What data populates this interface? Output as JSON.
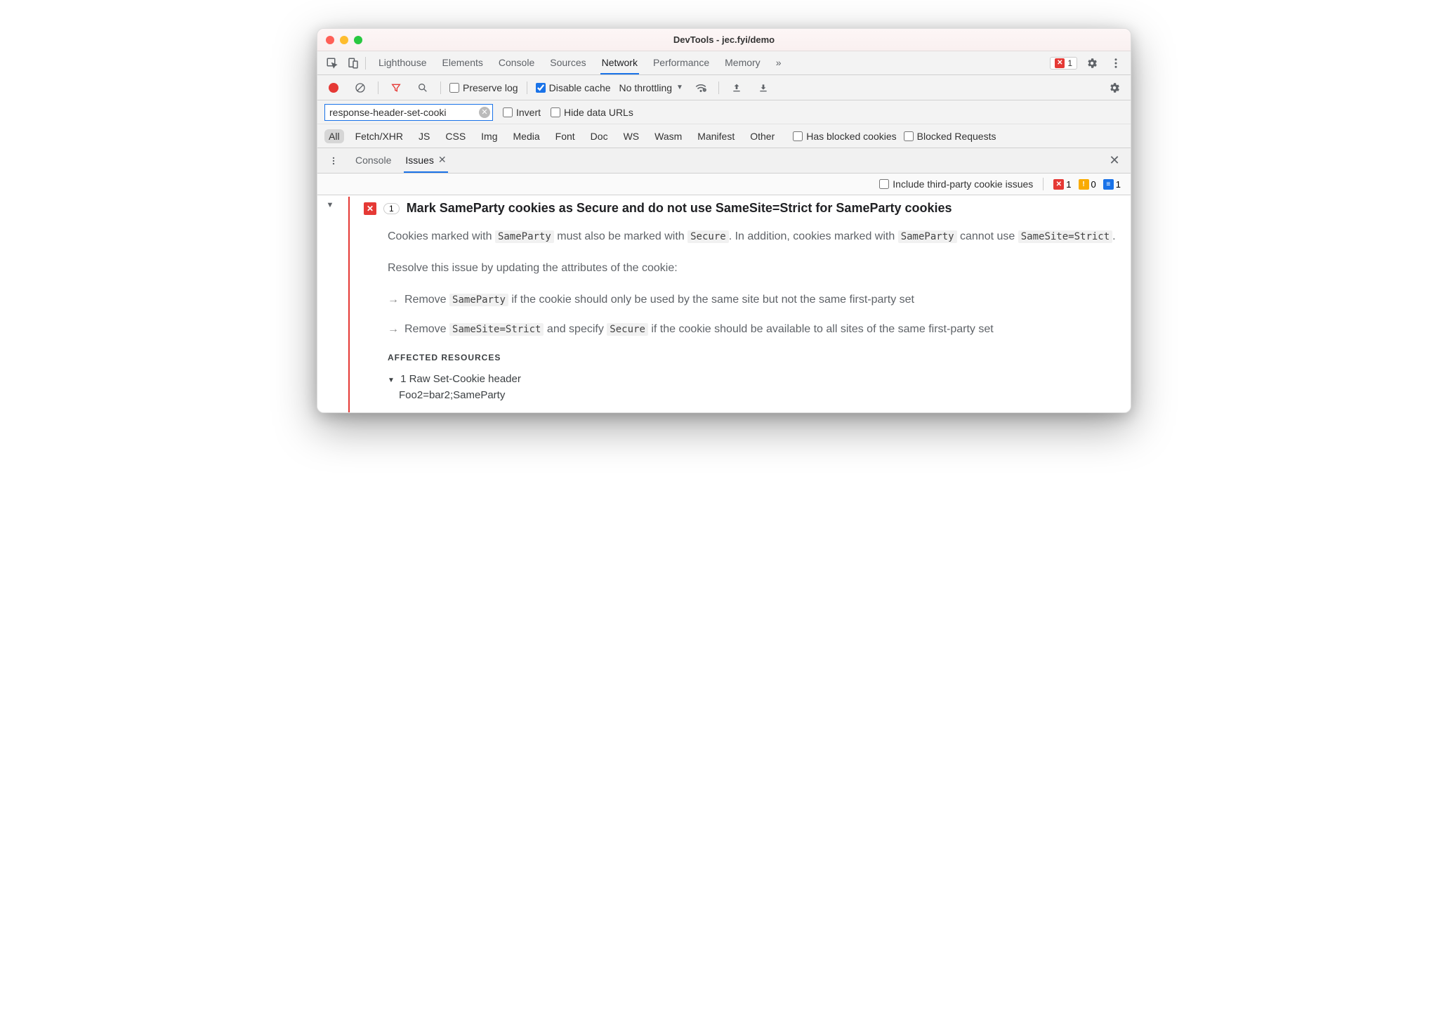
{
  "window": {
    "title": "DevTools - jec.fyi/demo"
  },
  "mainTabs": {
    "items": [
      "Lighthouse",
      "Elements",
      "Console",
      "Sources",
      "Network",
      "Performance",
      "Memory"
    ],
    "active": "Network",
    "overflow": "»"
  },
  "toolbarRight": {
    "errorCount": "1"
  },
  "networkBar": {
    "preserveLogLabel": "Preserve log",
    "disableCacheLabel": "Disable cache",
    "disableCacheChecked": true,
    "throttling": "No throttling"
  },
  "filter": {
    "value": "response-header-set-cooki",
    "invertLabel": "Invert",
    "hideDataUrlsLabel": "Hide data URLs"
  },
  "types": {
    "items": [
      "All",
      "Fetch/XHR",
      "JS",
      "CSS",
      "Img",
      "Media",
      "Font",
      "Doc",
      "WS",
      "Wasm",
      "Manifest",
      "Other"
    ],
    "active": "All",
    "hasBlockedCookiesLabel": "Has blocked cookies",
    "blockedRequestsLabel": "Blocked Requests"
  },
  "drawer": {
    "tabs": [
      "Console",
      "Issues"
    ],
    "active": "Issues"
  },
  "issuesToolbar": {
    "includeThirdPartyLabel": "Include third-party cookie issues",
    "counts": {
      "error": "1",
      "warning": "0",
      "info": "1"
    }
  },
  "issue": {
    "count": "1",
    "title": "Mark SameParty cookies as Secure and do not use SameSite=Strict for SameParty cookies",
    "para1_a": "Cookies marked with ",
    "para1_code1": "SameParty",
    "para1_b": " must also be marked with ",
    "para1_code2": "Secure",
    "para1_c": ". In addition, cookies marked with ",
    "para1_code3": "SameParty",
    "para1_d": " cannot use ",
    "para1_code4": "SameSite=Strict",
    "para1_e": ".",
    "para2": "Resolve this issue by updating the attributes of the cookie:",
    "bullet1_a": "Remove ",
    "bullet1_code": "SameParty",
    "bullet1_b": " if the cookie should only be used by the same site but not the same first-party set",
    "bullet2_a": "Remove ",
    "bullet2_code1": "SameSite=Strict",
    "bullet2_b": " and specify ",
    "bullet2_code2": "Secure",
    "bullet2_c": " if the cookie should be available to all sites of the same first-party set",
    "affectedHeading": "AFFECTED RESOURCES",
    "affectedItem": "1 Raw Set-Cookie header",
    "affectedValue": "Foo2=bar2;SameParty"
  }
}
